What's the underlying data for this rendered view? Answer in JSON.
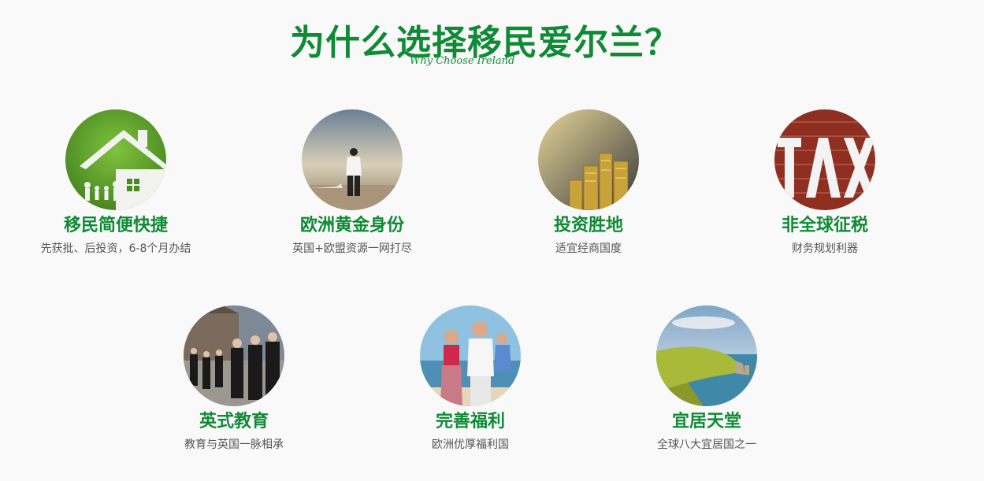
{
  "header": {
    "title": "为什么选择移民爱尔兰？",
    "subtitle": "Why Choose Ireland"
  },
  "features": [
    {
      "title": "移民简便快捷",
      "desc": "先获批、后投资，6-8个月办结",
      "image": "house-on-grass-image"
    },
    {
      "title": "欧洲黄金身份",
      "desc": "英国+欧盟资源一网打尽",
      "image": "businessman-airport-image"
    },
    {
      "title": "投资胜地",
      "desc": "适宜经商国度",
      "image": "gold-coins-image"
    },
    {
      "title": "非全球征税",
      "desc": "财务规划利器",
      "image": "tax-letters-image"
    },
    {
      "title": "英式教育",
      "desc": "教育与英国一脉相承",
      "image": "students-walking-image"
    },
    {
      "title": "完善福利",
      "desc": "欧洲优厚福利国",
      "image": "family-beach-image"
    },
    {
      "title": "宜居天堂",
      "desc": "全球八大宜居国之一",
      "image": "coastal-cliffs-image"
    }
  ],
  "colors": {
    "accent": "#0f8a35",
    "text": "#555555",
    "background": "#f9f9f9"
  }
}
